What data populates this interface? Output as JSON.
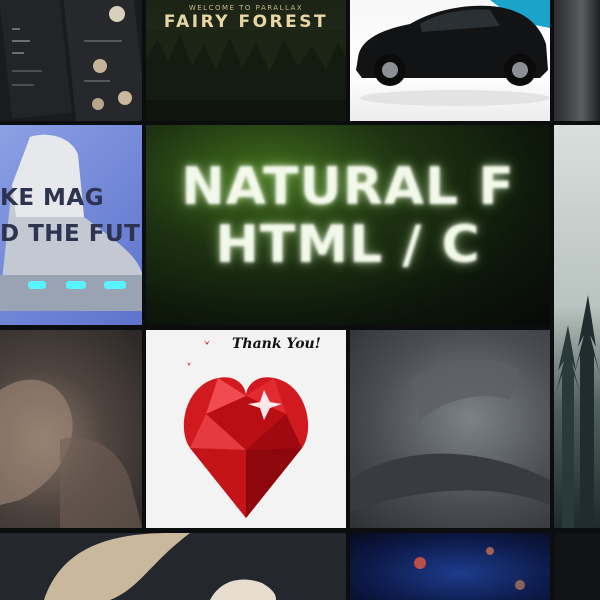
{
  "tiles": {
    "fairy_forest": {
      "kicker": "WELCOME TO PARALLAX",
      "title": "FAIRY FOREST"
    },
    "shoe": {
      "line1": "KE MAG",
      "line2": "D THE FUTU"
    },
    "natural": {
      "line1": "NATURAL F",
      "line2": "HTML / C"
    },
    "heart": {
      "caption": "Thank You!"
    }
  },
  "colors": {
    "background": "#0c0d0f",
    "fairy_title": "#e8d6a4",
    "shoe_bg": "#7388d8",
    "heart_red": "#d11a1f",
    "natural_glow": "#f3f9ea"
  },
  "icons": {
    "heart": "heart-icon",
    "car": "car-icon",
    "sneaker": "sneaker-icon"
  }
}
